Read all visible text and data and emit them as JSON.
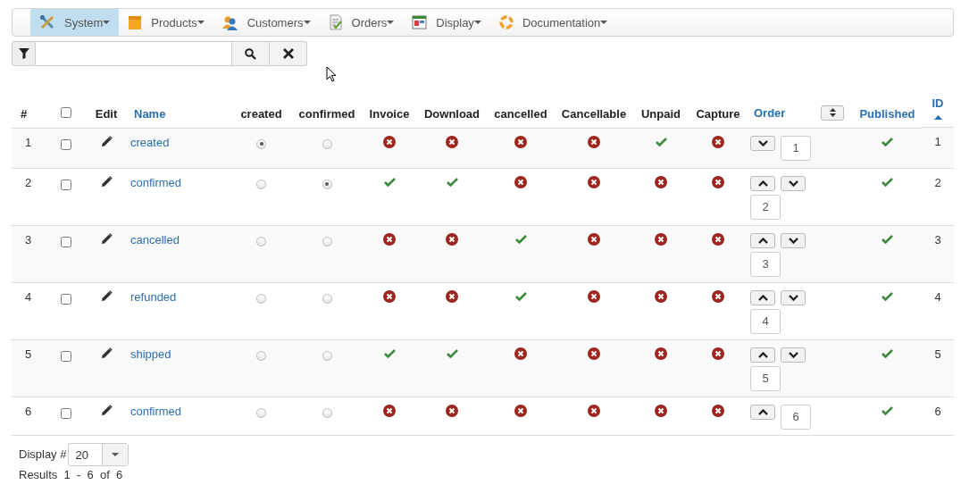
{
  "menu": [
    {
      "label": "System",
      "kind": "tools",
      "selected": true
    },
    {
      "label": "Products",
      "kind": "box",
      "selected": false
    },
    {
      "label": "Customers",
      "kind": "people",
      "selected": false
    },
    {
      "label": "Orders",
      "kind": "document",
      "selected": false
    },
    {
      "label": "Display",
      "kind": "window",
      "selected": false
    },
    {
      "label": "Documentation",
      "kind": "lifebuoy",
      "selected": false
    }
  ],
  "table": {
    "select_all_checked": false,
    "columns": {
      "number": "#",
      "edit": "Edit",
      "name": "Name",
      "radios": [
        "created",
        "confirmed"
      ],
      "flags": [
        "Invoice",
        "Download",
        "cancelled",
        "Cancellable",
        "Unpaid",
        "Capture"
      ],
      "order": "Order",
      "published": "Published",
      "id": "ID"
    },
    "rows": [
      {
        "number": "1",
        "checked": false,
        "name": "created",
        "radios": [
          {
            "selected": true
          },
          {
            "selected": false
          }
        ],
        "flags": [
          {
            "on": false
          },
          {
            "on": false
          },
          {
            "on": false
          },
          {
            "on": false
          },
          {
            "on": true
          },
          {
            "on": false
          }
        ],
        "order": {
          "up": false,
          "down": true,
          "value": "1"
        },
        "published": true,
        "id": "1"
      },
      {
        "number": "2",
        "checked": false,
        "name": "confirmed",
        "radios": [
          {
            "selected": false
          },
          {
            "selected": true
          }
        ],
        "flags": [
          {
            "on": true
          },
          {
            "on": true
          },
          {
            "on": false
          },
          {
            "on": false
          },
          {
            "on": false
          },
          {
            "on": false
          }
        ],
        "order": {
          "up": true,
          "down": true,
          "value": "2"
        },
        "published": true,
        "id": "2"
      },
      {
        "number": "3",
        "checked": false,
        "name": "cancelled",
        "radios": [
          {
            "selected": false
          },
          {
            "selected": false
          }
        ],
        "flags": [
          {
            "on": false
          },
          {
            "on": false
          },
          {
            "on": true
          },
          {
            "on": false
          },
          {
            "on": false
          },
          {
            "on": false
          }
        ],
        "order": {
          "up": true,
          "down": true,
          "value": "3"
        },
        "published": true,
        "id": "3"
      },
      {
        "number": "4",
        "checked": false,
        "name": "refunded",
        "radios": [
          {
            "selected": false
          },
          {
            "selected": false
          }
        ],
        "flags": [
          {
            "on": false
          },
          {
            "on": false
          },
          {
            "on": true
          },
          {
            "on": false
          },
          {
            "on": false
          },
          {
            "on": false
          }
        ],
        "order": {
          "up": true,
          "down": true,
          "value": "4"
        },
        "published": true,
        "id": "4"
      },
      {
        "number": "5",
        "checked": false,
        "name": "shipped",
        "radios": [
          {
            "selected": false
          },
          {
            "selected": false
          }
        ],
        "flags": [
          {
            "on": true
          },
          {
            "on": true
          },
          {
            "on": false
          },
          {
            "on": false
          },
          {
            "on": false
          },
          {
            "on": false
          }
        ],
        "order": {
          "up": true,
          "down": true,
          "value": "5"
        },
        "published": true,
        "id": "5"
      },
      {
        "number": "6",
        "checked": false,
        "name": "confirmed",
        "radios": [
          {
            "selected": false
          },
          {
            "selected": false
          }
        ],
        "flags": [
          {
            "on": false
          },
          {
            "on": false
          },
          {
            "on": false
          },
          {
            "on": false
          },
          {
            "on": false
          },
          {
            "on": false
          }
        ],
        "order": {
          "up": true,
          "down": false,
          "value": "6"
        },
        "published": true,
        "id": "6"
      }
    ]
  },
  "footer": {
    "display_label": "Display #",
    "display_value": "20",
    "results": "Results  1  -  6  of  6"
  }
}
